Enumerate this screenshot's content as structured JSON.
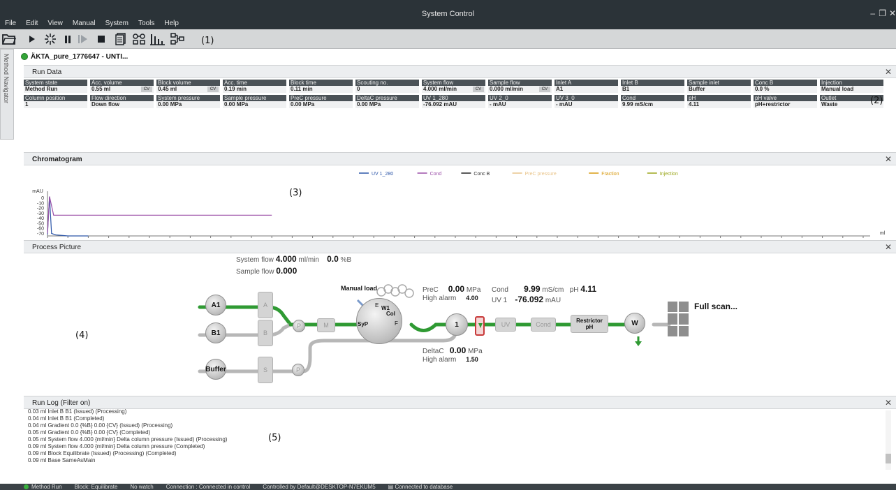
{
  "window": {
    "title": "System Control",
    "menu": [
      "File",
      "Edit",
      "View",
      "Manual",
      "System",
      "Tools",
      "Help"
    ]
  },
  "labels": {
    "toolbar": "(1)",
    "run_data": "(2)",
    "chromatogram": "(3)",
    "process_picture": "(4)",
    "run_log": "(5)"
  },
  "side_tab": "Method Navigator",
  "system_tab": "ÄKTA_pure_1776647 - UNTI...",
  "run_data": {
    "title": "Run Data",
    "row1": [
      {
        "label": "System state",
        "value": "Method Run"
      },
      {
        "label": "Acc. volume",
        "value": "0.55 ml",
        "badge": "CV"
      },
      {
        "label": "Block volume",
        "value": "0.45 ml",
        "badge": "CV"
      },
      {
        "label": "Acc. time",
        "value": "0.19 min"
      },
      {
        "label": "Block time",
        "value": "0.11 min"
      },
      {
        "label": "Scouting no.",
        "value": "0"
      },
      {
        "label": "System flow",
        "value": "4.000 ml/min",
        "badge": "CV"
      },
      {
        "label": "Sample flow",
        "value": "0.000 ml/min",
        "badge": "CV"
      },
      {
        "label": "Inlet A",
        "value": "A1"
      },
      {
        "label": "Inlet B",
        "value": "B1"
      },
      {
        "label": "Sample inlet",
        "value": "Buffer"
      },
      {
        "label": "Conc B",
        "value": "0.0 %"
      },
      {
        "label": "Injection",
        "value": "Manual load"
      }
    ],
    "row2": [
      {
        "label": "Column position",
        "value": "1"
      },
      {
        "label": "Flow direction",
        "value": "Down flow"
      },
      {
        "label": "System pressure",
        "value": "0.00 MPa"
      },
      {
        "label": "Sample pressure",
        "value": "0.00 MPa"
      },
      {
        "label": "PreC pressure",
        "value": "0.00 MPa"
      },
      {
        "label": "DeltaC pressure",
        "value": "0.00 MPa"
      },
      {
        "label": "UV 1_280",
        "value": "-76.092 mAU"
      },
      {
        "label": "UV 2_0",
        "value": "- mAU"
      },
      {
        "label": "UV 3_0",
        "value": "- mAU"
      },
      {
        "label": "Cond",
        "value": "9.99 mS/cm"
      },
      {
        "label": "pH",
        "value": "4.11"
      },
      {
        "label": "pH valve",
        "value": "pH+restrictor"
      },
      {
        "label": "Outlet",
        "value": "Waste"
      }
    ]
  },
  "chromatogram_panel": {
    "title": "Chromatogram"
  },
  "chart_data": {
    "type": "line",
    "ylabel": "mAU",
    "xlabel": "ml",
    "ylim": [
      -75,
      5
    ],
    "xlim": [
      0,
      2
    ],
    "yticks": [
      "0",
      "-10",
      "-20",
      "-30",
      "-40",
      "-50",
      "-60",
      "-70"
    ],
    "xticks": [
      "0",
      "0.05",
      "0.1",
      "0.15",
      "0.2",
      "0.25",
      "0.3",
      "0.35",
      "0.4",
      "0.45",
      "0.5",
      "0.55",
      "0.6",
      "0.65",
      "0.7",
      "0.75",
      "0.8",
      "0.85",
      "0.9",
      "0.95",
      "1",
      "1.05",
      "1.1",
      "1.15",
      "1.2",
      "1.25",
      "1.3",
      "1.35",
      "1.4",
      "1.45",
      "1.5",
      "1.55",
      "1.6",
      "1.65",
      "1.7",
      "1.75",
      "1.8",
      "1.85",
      "1.9",
      "1.95",
      "2"
    ],
    "legend_position": "top-center",
    "series": [
      {
        "name": "UV 1_280",
        "color": "#2b55a8",
        "x": [
          0,
          0.005,
          0.01,
          0.02,
          0.05,
          0.1
        ],
        "y": [
          -72,
          3,
          -70,
          -73,
          -75,
          -75
        ]
      },
      {
        "name": "Cond",
        "color": "#9b4fa8",
        "x": [
          0,
          0.005,
          0.015,
          0.55
        ],
        "y": [
          -70,
          3,
          -34,
          -34
        ]
      },
      {
        "name": "Conc B",
        "color": "#222222",
        "x": [],
        "y": []
      },
      {
        "name": "PreC pressure",
        "color": "#e9c48a",
        "x": [],
        "y": []
      },
      {
        "name": "Fraction",
        "color": "#d89a10",
        "x": [],
        "y": []
      },
      {
        "name": "Injection",
        "color": "#9aa61a",
        "x": [],
        "y": []
      }
    ]
  },
  "process_picture": {
    "title": "Process Picture",
    "system_flow_label": "System flow",
    "system_flow_value": "4.000",
    "system_flow_unit": "ml/min",
    "conc_value": "0.0",
    "conc_unit": "%B",
    "sample_flow_label": "Sample flow",
    "sample_flow_value": "0.000",
    "manual_load": "Manual load",
    "prec_label": "PreC",
    "prec_value": "0.00",
    "prec_unit": "MPa",
    "prec_alarm_label": "High alarm",
    "prec_alarm_value": "4.00",
    "cond_label": "Cond",
    "cond_value": "9.99",
    "cond_unit": "mS/cm",
    "ph_label": "pH",
    "ph_value": "4.11",
    "uv_label": "UV 1",
    "uv_value": "-76.092",
    "uv_unit": "mAU",
    "deltac_label": "DeltaC",
    "deltac_value": "0.00",
    "deltac_unit": "MPa",
    "deltac_alarm_label": "High alarm",
    "deltac_alarm_value": "1.50",
    "full_scan": "Full scan...",
    "inlet_a": "A1",
    "inlet_b": "B1",
    "inlet_buffer": "Buffer",
    "box_a": "A",
    "box_b": "B",
    "box_s": "S",
    "pump_p": "P",
    "mixer": "M",
    "valve_ports": {
      "e": "E",
      "w1": "W1",
      "col": "Col",
      "syp": "SyP",
      "f": "F"
    },
    "column_pos": "1",
    "uv_box": "UV",
    "cond_box": "Cond",
    "restrictor": "Restrictor",
    "restrictor_ph": "pH",
    "waste": "W"
  },
  "run_log": {
    "title": "Run Log (Filter on)",
    "entries": [
      "0.03 ml Inlet B B1 (Issued) (Processing)",
      "0.04 ml Inlet B B1 (Completed)",
      "0.04 ml Gradient 0.0 {%B} 0.00 {CV} (Issued) (Processing)",
      "0.05 ml Gradient 0.0 {%B} 0.00 {CV} (Completed)",
      "0.05 ml System flow 4.000 {ml/min} Delta column pressure (Issued) (Processing)",
      "0.09 ml System flow 4.000 {ml/min} Delta column pressure (Completed)",
      "0.09 ml Block Equilibrate (Issued) (Processing) (Completed)",
      "0.09 ml Base SameAsMain"
    ]
  },
  "status_bar": {
    "state": "Method Run",
    "block": "Block: Equilibrate",
    "watch": "No watch",
    "connection": "Connection : Connected in control",
    "controlled": "Controlled by Default@DESKTOP-N7EKUM5",
    "database": "Connected to database"
  }
}
